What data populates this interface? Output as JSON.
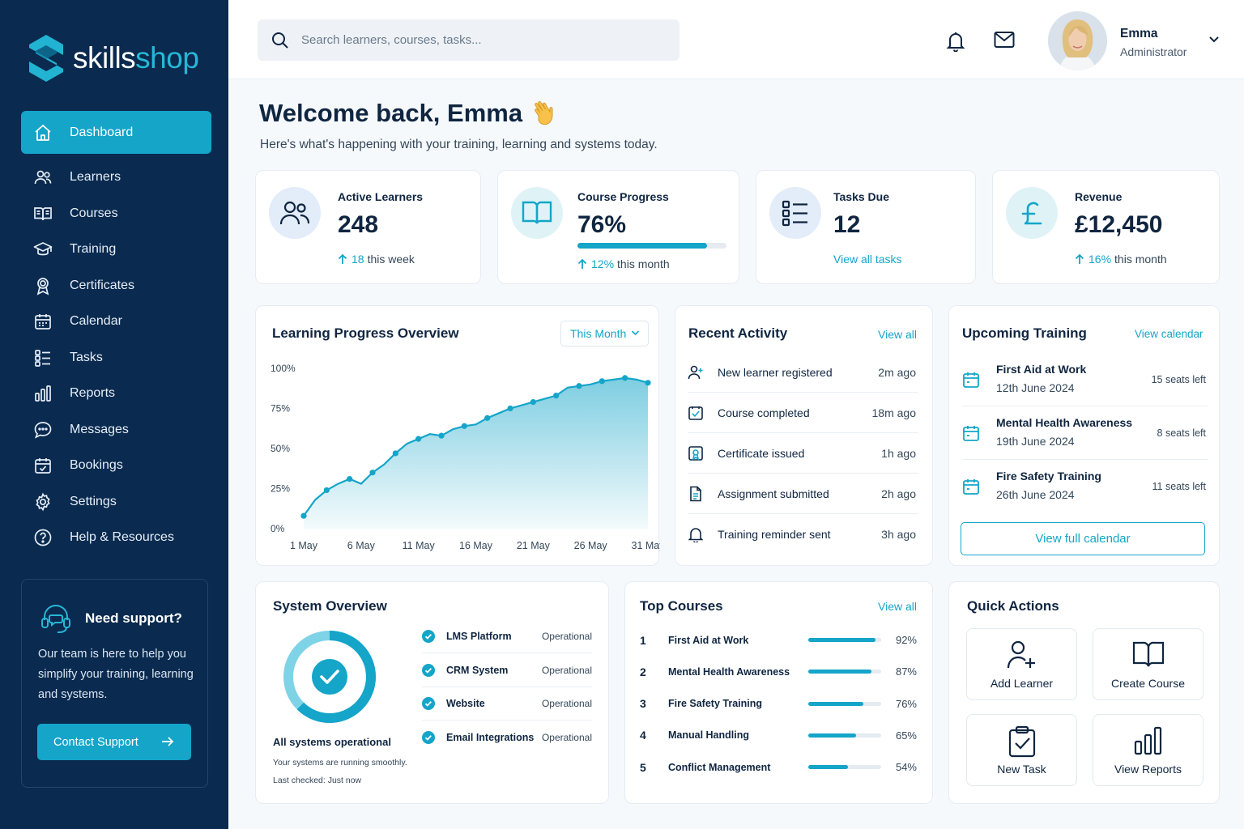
{
  "brand": {
    "part1": "skills",
    "part2": "shop",
    "accent": "#14a5c9",
    "navy": "#0a2a4f"
  },
  "sidebar": {
    "items": [
      {
        "label": "Dashboard",
        "icon": "home-icon",
        "active": true
      },
      {
        "label": "Learners",
        "icon": "users-icon"
      },
      {
        "label": "Courses",
        "icon": "book-icon"
      },
      {
        "label": "Training",
        "icon": "graduation-cap-icon"
      },
      {
        "label": "Certificates",
        "icon": "award-icon"
      },
      {
        "label": "Calendar",
        "icon": "calendar-icon"
      },
      {
        "label": "Tasks",
        "icon": "checklist-icon"
      },
      {
        "label": "Reports",
        "icon": "bar-chart-icon"
      },
      {
        "label": "Messages",
        "icon": "chat-icon"
      },
      {
        "label": "Bookings",
        "icon": "calendar-check-icon"
      },
      {
        "label": "Settings",
        "icon": "gear-icon"
      },
      {
        "label": "Help & Resources",
        "icon": "help-icon"
      }
    ],
    "support": {
      "title": "Need support?",
      "text": "Our team is here to help you simplify your training, learning and systems.",
      "button": "Contact Support"
    }
  },
  "topbar": {
    "search_placeholder": "Search learners, courses, tasks...",
    "user": {
      "name": "Emma",
      "role": "Administrator"
    }
  },
  "header": {
    "title": "Welcome back, Emma",
    "subtitle": "Here's what's happening with your training, learning and systems today."
  },
  "kpis": {
    "learners": {
      "label": "Active Learners",
      "value": "248",
      "change": "18",
      "period": "this week"
    },
    "progress": {
      "label": "Course Progress",
      "value": "76%",
      "change": "12%",
      "period": "this month",
      "fraction": 0.87
    },
    "tasks": {
      "label": "Tasks Due",
      "value": "12",
      "link": "View all tasks"
    },
    "revenue": {
      "label": "Revenue",
      "value": "£12,450",
      "change": "16%",
      "period": "this month"
    }
  },
  "learning_chart": {
    "title": "Learning Progress Overview",
    "filter": "This Month",
    "chart_data": {
      "type": "area",
      "x": [
        1,
        2,
        3,
        4,
        5,
        6,
        7,
        8,
        9,
        10,
        11,
        12,
        13,
        14,
        15,
        16,
        17,
        18,
        19,
        20,
        21,
        22,
        23,
        24,
        25,
        26,
        27,
        28,
        29,
        30,
        31
      ],
      "x_ticks": [
        "1 May",
        "6 May",
        "11 May",
        "16 May",
        "21 May",
        "26 May",
        "31 May"
      ],
      "y_ticks": [
        "100%",
        "75%",
        "50%",
        "25%",
        "0%"
      ],
      "ylim": [
        0,
        100
      ],
      "values": [
        8,
        18,
        24,
        28,
        31,
        28,
        35,
        40,
        47,
        53,
        56,
        59,
        58,
        62,
        64,
        65,
        69,
        72,
        75,
        77,
        79,
        81,
        83,
        88,
        89,
        90,
        92,
        93,
        94,
        93,
        91
      ],
      "grid": false
    }
  },
  "activity": {
    "title": "Recent Activity",
    "link": "View all",
    "items": [
      {
        "text": "New learner registered",
        "time": "2m ago",
        "icon": "user-plus-icon"
      },
      {
        "text": "Course completed",
        "time": "18m ago",
        "icon": "check-square-icon"
      },
      {
        "text": "Certificate issued",
        "time": "1h ago",
        "icon": "certificate-icon"
      },
      {
        "text": "Assignment submitted",
        "time": "2h ago",
        "icon": "document-icon"
      },
      {
        "text": "Training reminder sent",
        "time": "3h ago",
        "icon": "bell-icon"
      }
    ]
  },
  "upcoming": {
    "title": "Upcoming Training",
    "link": "View calendar",
    "items": [
      {
        "name": "First Aid at Work",
        "date": "12th June 2024",
        "seats": "15 seats left"
      },
      {
        "name": "Mental Health Awareness",
        "date": "19th June 2024",
        "seats": "8 seats left"
      },
      {
        "name": "Fire Safety Training",
        "date": "26th June 2024",
        "seats": "11 seats left"
      }
    ],
    "button": "View full calendar"
  },
  "system": {
    "title": "System Overview",
    "status_title": "All systems operational",
    "status_text": "Your systems are running smoothly.",
    "last_checked": "Last checked: Just now",
    "items": [
      {
        "name": "LMS Platform",
        "status": "Operational"
      },
      {
        "name": "CRM System",
        "status": "Operational"
      },
      {
        "name": "Website",
        "status": "Operational"
      },
      {
        "name": "Email Integrations",
        "status": "Operational"
      }
    ]
  },
  "top_courses": {
    "title": "Top Courses",
    "link": "View all",
    "items": [
      {
        "rank": "1",
        "name": "First Aid at Work",
        "pct": "92%",
        "value": 92
      },
      {
        "rank": "2",
        "name": "Mental Health Awareness",
        "pct": "87%",
        "value": 87
      },
      {
        "rank": "3",
        "name": "Fire Safety Training",
        "pct": "76%",
        "value": 76
      },
      {
        "rank": "4",
        "name": "Manual Handling",
        "pct": "65%",
        "value": 65
      },
      {
        "rank": "5",
        "name": "Conflict Management",
        "pct": "54%",
        "value": 54
      }
    ]
  },
  "quick_actions": {
    "title": "Quick Actions",
    "items": [
      {
        "label": "Add Learner",
        "icon": "user-plus-icon"
      },
      {
        "label": "Create Course",
        "icon": "book-icon"
      },
      {
        "label": "New Task",
        "icon": "clipboard-check-icon"
      },
      {
        "label": "View Reports",
        "icon": "bar-chart-icon"
      }
    ]
  }
}
